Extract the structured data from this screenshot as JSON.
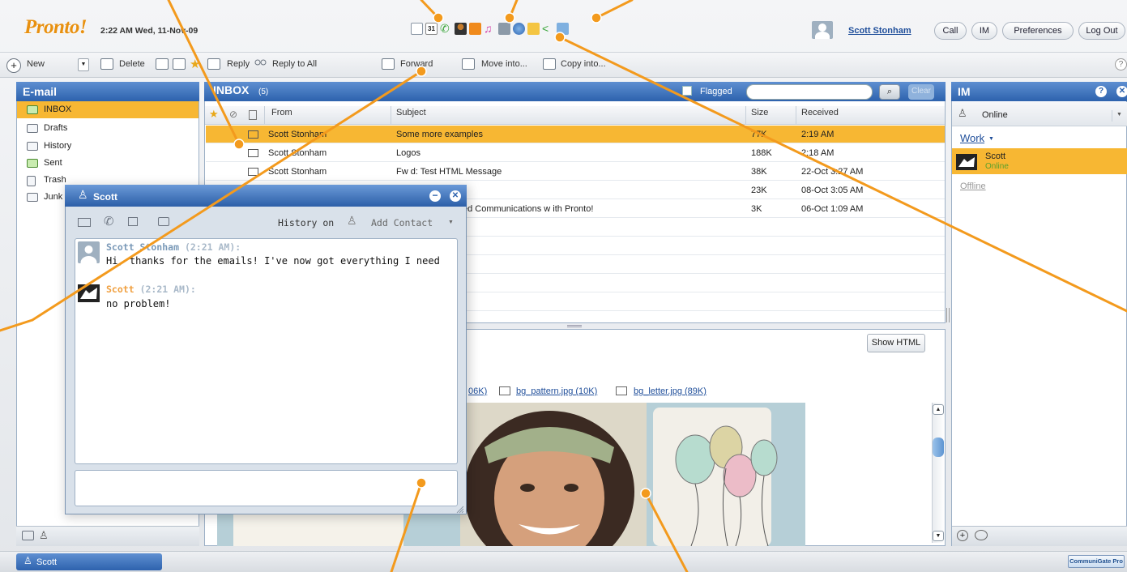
{
  "header": {
    "logo": "Pronto!",
    "clock": "2:22 AM Wed, 11-Nov-09",
    "user": "Scott Stonham",
    "buttons": [
      "Call",
      "IM",
      "Preferences",
      "Log Out"
    ],
    "icons": [
      "mail-icon",
      "calendar-icon",
      "phone-icon",
      "contacts-icon",
      "rss-icon",
      "music-icon",
      "photos-icon",
      "web-icon",
      "files-icon",
      "share-icon",
      "notes-icon"
    ],
    "calendar_day": "31"
  },
  "toolbar": {
    "new": "New",
    "delete": "Delete",
    "reply": "Reply",
    "reply_all": "Reply to All",
    "forward": "Forward",
    "move": "Move into...",
    "copy": "Copy into..."
  },
  "email_pane": {
    "title": "E-mail",
    "folders": [
      "INBOX",
      "Drafts",
      "History",
      "Sent",
      "Trash",
      "Junk"
    ]
  },
  "inbox": {
    "title": "INBOX",
    "count": "(5)",
    "flagged_label": "Flagged",
    "clear_label": "Clear",
    "columns": {
      "from": "From",
      "subject": "Subject",
      "size": "Size",
      "received": "Received"
    },
    "rows": [
      {
        "from": "Scott Stonham",
        "subject": "Some more examples",
        "size": "77K",
        "received": "2:19 AM"
      },
      {
        "from": "Scott Stonham",
        "subject": "Logos",
        "size": "188K",
        "received": "2:18 AM"
      },
      {
        "from": "Scott Stonham",
        "subject": "Fw d: Test HTML Message",
        "size": "38K",
        "received": "22-Oct 3:27 AM"
      },
      {
        "from": "",
        "subject": "",
        "size": "23K",
        "received": "08-Oct 3:05 AM"
      },
      {
        "from": "",
        "subject": "ed Communications w ith Pronto!",
        "size": "3K",
        "received": "06-Oct 1:09 AM"
      }
    ]
  },
  "preview": {
    "show_html": "Show HTML",
    "attachments": [
      "06K)",
      "bg_pattern.jpg (10K)",
      "bg_letter.jpg (89K)"
    ]
  },
  "chat": {
    "title": "Scott",
    "history": "History on",
    "add_contact": "Add Contact",
    "messages": [
      {
        "author": "Scott Stonham",
        "time": "(2:21 AM):",
        "text": "Hi, thanks for the emails! I've now got everything I need"
      },
      {
        "author": "Scott",
        "time": "(2:21 AM):",
        "text": "no problem!"
      }
    ]
  },
  "im": {
    "title": "IM",
    "status": "Online",
    "group": "Work",
    "contact_name": "Scott",
    "contact_status": "Online",
    "offline": "Offline"
  },
  "taskbar": {
    "chat_tab": "Scott",
    "brand": "CommuniGate Pro"
  },
  "colors": {
    "accent": "#e8900f",
    "header_blue": "#2d62ad",
    "selected_row": "#f7b733",
    "annotation": "#f39a1d"
  }
}
